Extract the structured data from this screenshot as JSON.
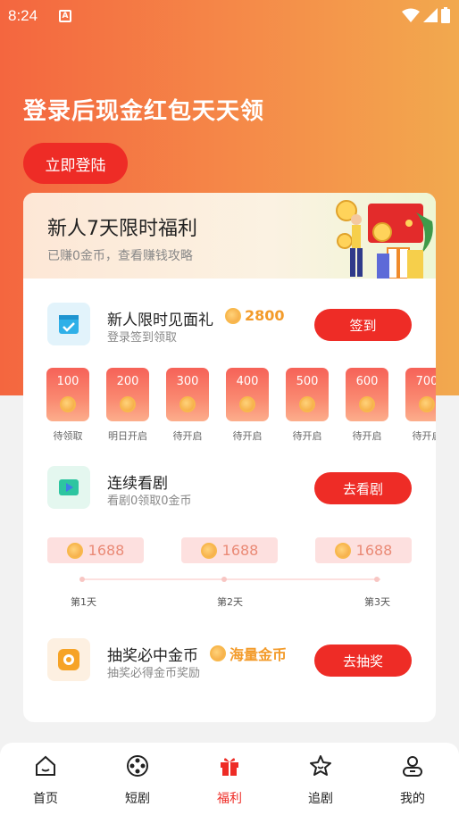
{
  "status": {
    "time": "8:24",
    "indicator": "A"
  },
  "hero": {
    "title": "登录后现金红包天天领",
    "login_button": "立即登陆"
  },
  "card": {
    "title": "新人7天限时福利",
    "subtitle": "已赚0金币，查看赚钱攻略",
    "checkin": {
      "title": "新人限时见面礼",
      "reward": "2800",
      "subtitle": "登录签到领取",
      "button": "签到"
    },
    "days": [
      {
        "amount": "100",
        "label": "待领取"
      },
      {
        "amount": "200",
        "label": "明日开启"
      },
      {
        "amount": "300",
        "label": "待开启"
      },
      {
        "amount": "400",
        "label": "待开启"
      },
      {
        "amount": "500",
        "label": "待开启"
      },
      {
        "amount": "600",
        "label": "待开启"
      },
      {
        "amount": "700",
        "label": "待开启"
      }
    ],
    "watch": {
      "title": "连续看剧",
      "subtitle": "看剧0领取0金币",
      "button": "去看剧"
    },
    "progress": [
      {
        "amount": "1688",
        "day": "第1天"
      },
      {
        "amount": "1688",
        "day": "第2天"
      },
      {
        "amount": "1688",
        "day": "第3天"
      }
    ],
    "lottery": {
      "title": "抽奖必中金币",
      "reward": "海量金币",
      "subtitle": "抽奖必得金币奖励",
      "button": "去抽奖"
    }
  },
  "tabs": [
    {
      "label": "首页",
      "icon": "home-icon"
    },
    {
      "label": "短剧",
      "icon": "film-reel-icon"
    },
    {
      "label": "福利",
      "icon": "gift-icon",
      "active": true
    },
    {
      "label": "追剧",
      "icon": "star-person-icon"
    },
    {
      "label": "我的",
      "icon": "user-icon"
    }
  ],
  "colors": {
    "accent": "#ee2c26",
    "reward": "#f39b2a",
    "hero_start": "#f4663f",
    "hero_end": "#f2a94e"
  }
}
